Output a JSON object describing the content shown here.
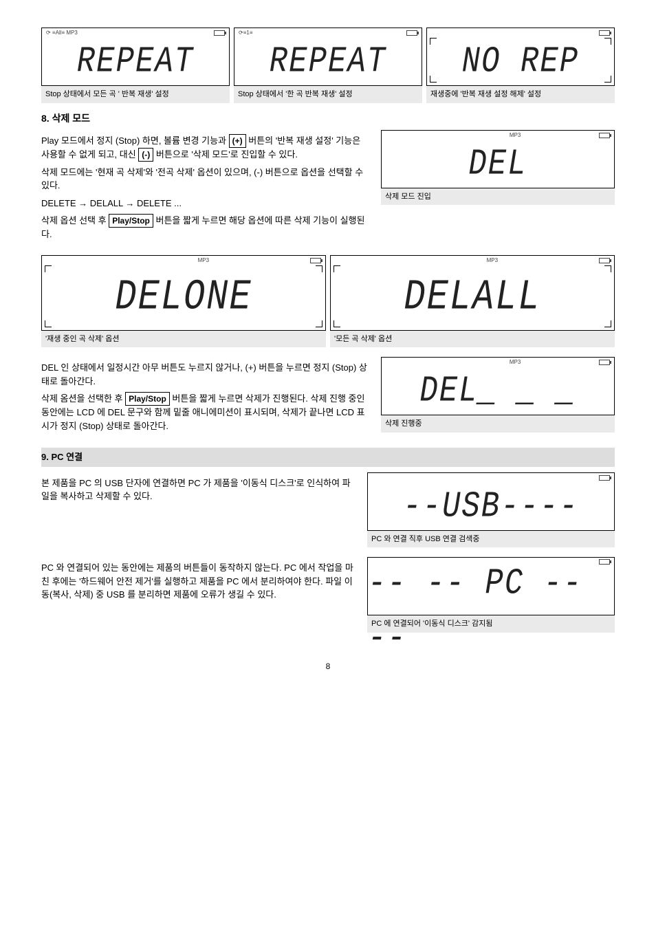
{
  "screens": {
    "repeat_all": {
      "indicators": "⟳ ≡All≡ MP3",
      "text": "REPEAT",
      "caption": "Stop 상태에서 모든 곡 ' 반복 재생' 설정"
    },
    "repeat_one": {
      "indicators": "⟳≡1≡",
      "text": "REPEAT",
      "caption": "Stop 상태에서 '한 곡 반복 재생' 설정"
    },
    "no_rep": {
      "indicators": "",
      "text": "NO  REP",
      "caption": "재생중에 '반복 재생 설정 해제' 설정"
    },
    "del": {
      "indicators": "MP3",
      "text": "DEL",
      "caption": "삭제 모드 진입"
    },
    "del_one": {
      "indicators": "MP3",
      "text": "DELONE",
      "caption": "'재생 중인 곡 삭제' 옵션"
    },
    "del_all": {
      "indicators": "MP3",
      "text": "DELALL",
      "caption": "'모든 곡 삭제' 옵션"
    },
    "del_progress": {
      "indicators": "MP3",
      "text": "DEL_ _ _",
      "caption": "삭제 진행중"
    },
    "usb": {
      "indicators": "",
      "text": "--USB----",
      "caption": "PC 와 연결 직후 USB 연결 검색중"
    },
    "pc": {
      "indicators": "",
      "text": "-- -- PC -- --",
      "caption": "PC 에 연결되어 '이동식 디스크' 감지됨"
    }
  },
  "text": {
    "sec8_title": "8. 삭제 모드",
    "sec8_p1a": "Play 모드에서 정지 (Stop) 하면, 볼륨 변경 기능과",
    "sec8_p1b": " 버튼의 '반복 재생 설정' 기능은 사용할 수 없게 되고, 대신",
    "sec8_p1c": " 버튼으로 '삭제 모드'로 진입할 수 있다.",
    "sec8_opt": "삭제 모드에는 '현재 곡 삭제'와 '전곡 삭제' 옵션이 있으며, (-) 버튼으로 옵션을 선택할 수 있다.",
    "sec8_cycle": "DELETE → DELALL → DELETE ...",
    "sec8_p2a": "삭제 옵션 선택 후",
    "sec8_p2b": " 버튼을 짧게 누르면 해당 옵션에 따른 삭제 기능이 실행된다.",
    "sec8_p3": "DEL 인 상태에서 일정시간 아무 버튼도 누르지 않거나, (+) 버튼을 누르면 정지 (Stop) 상태로 돌아간다.",
    "sec8_p4a": "삭제 옴션을 선택한 후",
    "sec8_p4b": " 버튼을 짧게 누르면 삭제가 진행된다. 삭제 진행 중인 동안에는 LCD 에 DEL 문구와 함께 밑줄 애니에미션이 표시되며, 삭제가 끝나면 LCD 표시가 정지 (Stop) 상태로 돌아간다.",
    "sec9_title": "9. PC 연결",
    "sec9_p1": "본 제품을 PC 의 USB 단자에 연결하면 PC 가 제품을 '이동식 디스크'로 인식하여 파일을 복사하고 삭제할 수 있다.",
    "sec9_p2": "PC 와 연결되어 있는 동안에는 제품의 버튼들이 동작하지 않는다. PC 에서 작업을 마친 후에는 '하드웨어 안전 제거'를 실행하고 제품을 PC 에서 분리하여야 한다. 파일 이동(복사, 삭제) 중 USB 를 분리하면 제품에 오류가 생길 수 있다.",
    "btn_plus": "(+)",
    "btn_minus": "(-)",
    "btn_playstop": "Play/Stop",
    "page": "8"
  }
}
